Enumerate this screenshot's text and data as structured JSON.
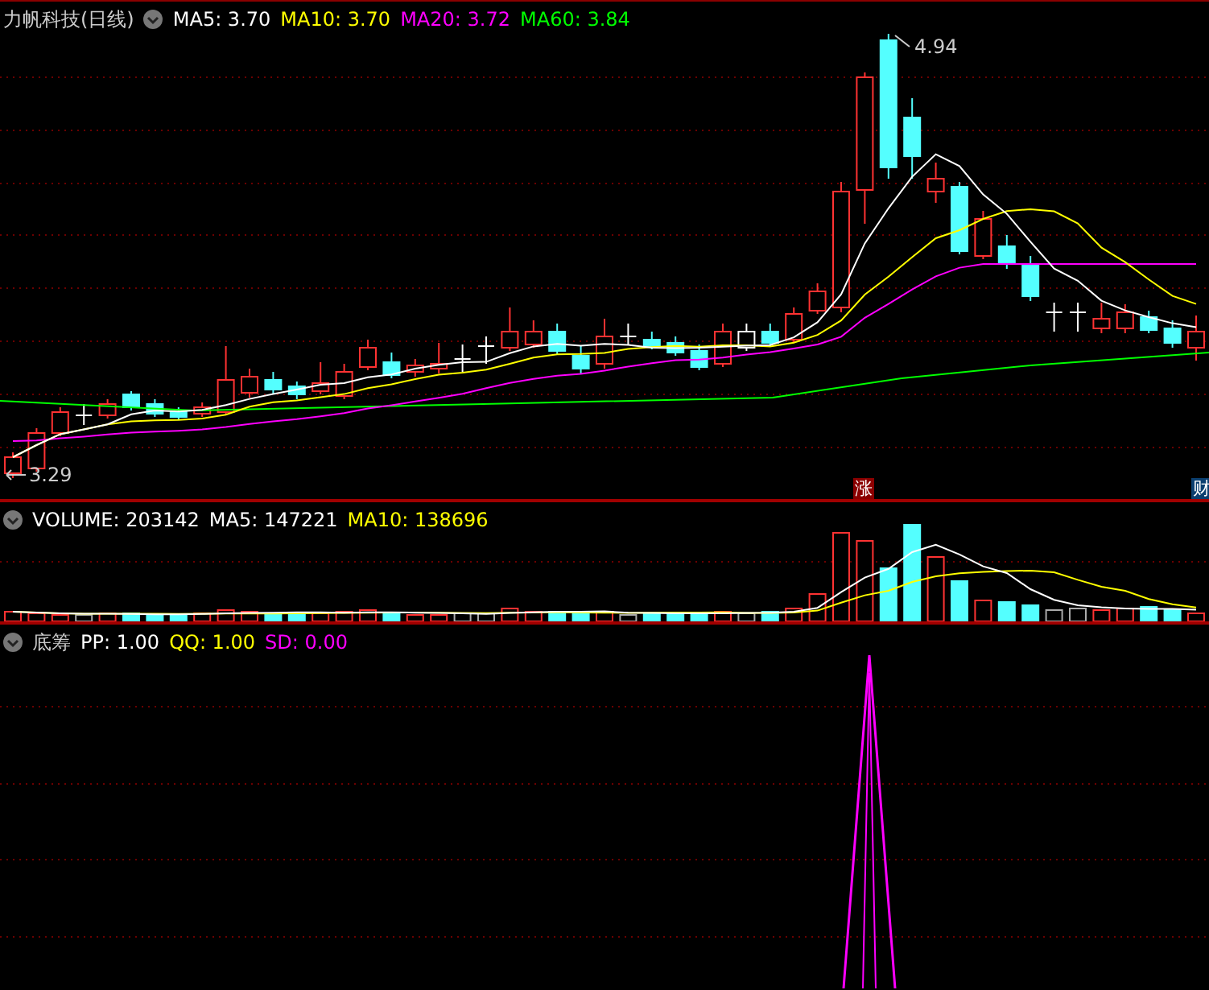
{
  "main_panel": {
    "title": "力帆科技(日线)",
    "indicators": [
      {
        "label": "MA5: 3.70",
        "color": "#ffffff"
      },
      {
        "label": "MA10: 3.70",
        "color": "#ffff00"
      },
      {
        "label": "MA20: 3.72",
        "color": "#ff00ff"
      },
      {
        "label": "MA60: 3.84",
        "color": "#00ff00"
      }
    ],
    "high_label": "4.94",
    "low_label": "3.29",
    "event_markers": [
      {
        "text": "涨",
        "color": "#8b0000"
      },
      {
        "text": "财",
        "color": "#0b3f70"
      }
    ]
  },
  "volume_panel": {
    "indicators": [
      {
        "label": "VOLUME: 203142",
        "color": "#ffffff"
      },
      {
        "label": "MA5: 147221",
        "color": "#ffffff"
      },
      {
        "label": "MA10: 138696",
        "color": "#ffff00"
      }
    ]
  },
  "chip_panel": {
    "title": "底筹",
    "indicators": [
      {
        "label": "PP: 1.00",
        "color": "#ffffff"
      },
      {
        "label": "QQ: 1.00",
        "color": "#ffff00"
      },
      {
        "label": "SD: 0.00",
        "color": "#ff00ff"
      }
    ]
  }
}
